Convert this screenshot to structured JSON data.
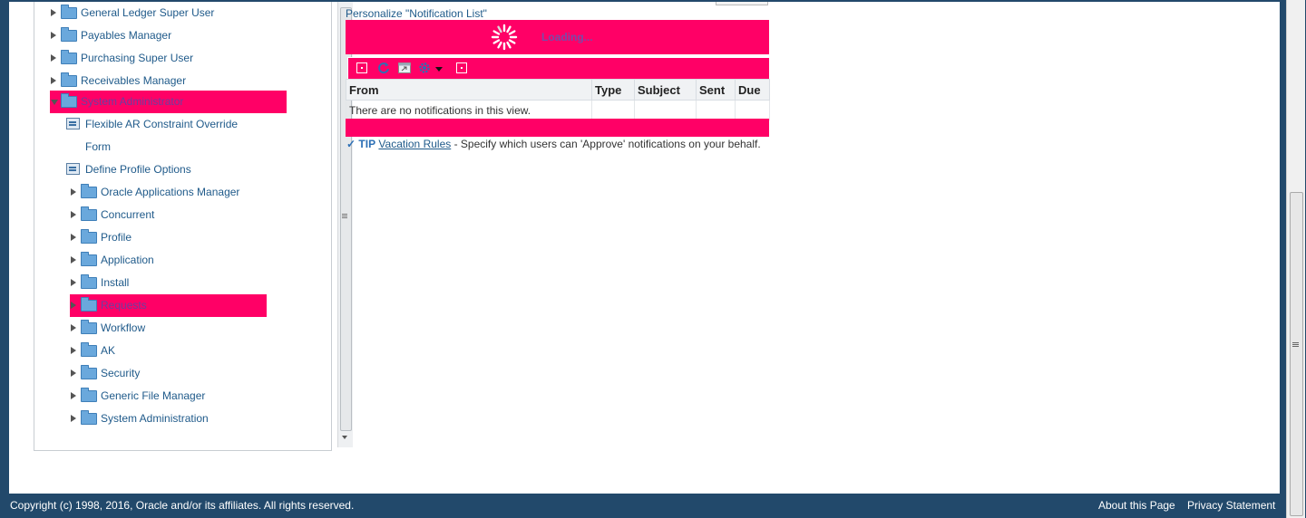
{
  "nav": {
    "items": [
      {
        "label": "General Ledger Super User"
      },
      {
        "label": "Payables Manager"
      },
      {
        "label": "Purchasing Super User"
      },
      {
        "label": "Receivables Manager"
      },
      {
        "label": "System Administrator"
      },
      {
        "label": "Flexible AR Constraint Override"
      },
      {
        "label": "Form"
      },
      {
        "label": "Define Profile Options"
      },
      {
        "label": "Oracle Applications Manager"
      },
      {
        "label": "Concurrent"
      },
      {
        "label": "Profile"
      },
      {
        "label": "Application"
      },
      {
        "label": "Install"
      },
      {
        "label": "Requests"
      },
      {
        "label": "Workflow"
      },
      {
        "label": "AK"
      },
      {
        "label": "Security"
      },
      {
        "label": "Generic File Manager"
      },
      {
        "label": "System Administration"
      }
    ]
  },
  "worklist": {
    "personalize_link": "Personalize \"Notification List\"",
    "loading_text": "Loading...",
    "columns": [
      "From",
      "Type",
      "Subject",
      "Sent",
      "Due"
    ],
    "empty_message": "There are no notifications in this view.",
    "tip_label": "TIP",
    "tip_link": "Vacation Rules",
    "tip_text": " - Specify which users can 'Approve' notifications on your behalf."
  },
  "footer": {
    "copyright": "Copyright (c) 1998, 2016, Oracle and/or its affiliates. All rights reserved.",
    "about": "About this Page",
    "privacy": "Privacy Statement"
  },
  "colors": {
    "highlight": "#ff0066",
    "frame": "#22496b",
    "link": "#1f5a8a"
  }
}
